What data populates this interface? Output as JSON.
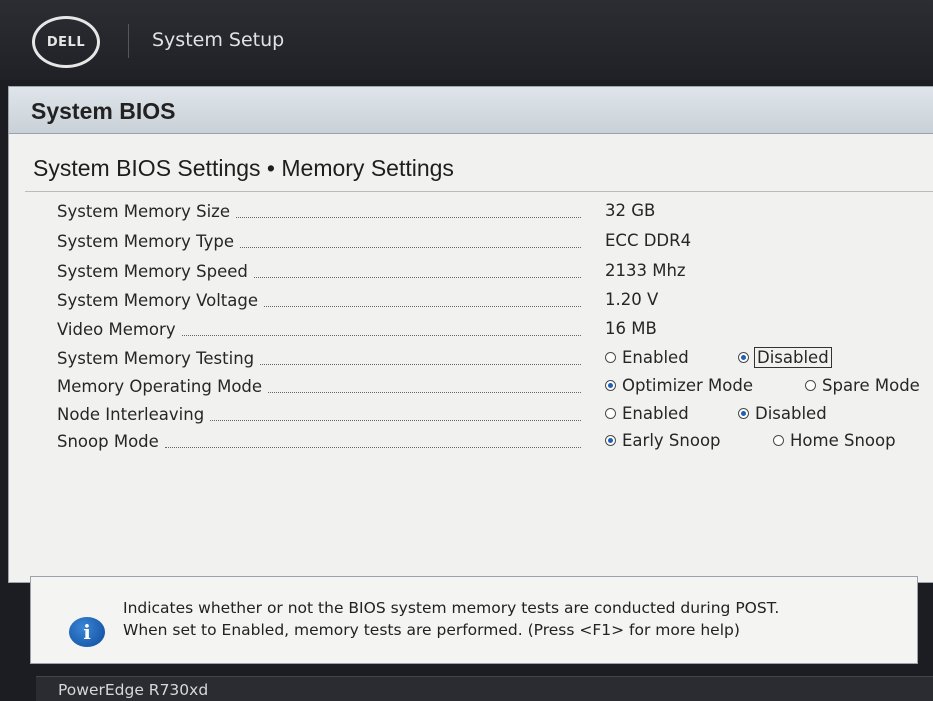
{
  "window": {
    "logo_text": "DELL",
    "title": "System Setup"
  },
  "panel": {
    "title": "System BIOS",
    "section_title": "System BIOS Settings • Memory Settings"
  },
  "settings": [
    {
      "label": "System Memory Size",
      "value": "32 GB"
    },
    {
      "label": "System Memory Type",
      "value": "ECC DDR4"
    },
    {
      "label": "System Memory Speed",
      "value": "2133 Mhz"
    },
    {
      "label": "System Memory Voltage",
      "value": "1.20 V"
    },
    {
      "label": "Video Memory",
      "value": "16 MB"
    },
    {
      "label": "System Memory Testing",
      "options": [
        "Enabled",
        "Disabled"
      ],
      "selected": "Disabled"
    },
    {
      "label": "Memory Operating Mode",
      "options": [
        "Optimizer Mode",
        "Spare Mode"
      ],
      "selected": "Optimizer Mode"
    },
    {
      "label": "Node Interleaving",
      "options": [
        "Enabled",
        "Disabled"
      ],
      "selected": "Disabled"
    },
    {
      "label": "Snoop Mode",
      "options": [
        "Early Snoop",
        "Home Snoop"
      ],
      "selected": "Early Snoop"
    }
  ],
  "help": {
    "icon": "info-icon",
    "line1": "Indicates whether or not the BIOS system memory tests are conducted during POST.",
    "line2": "When set to Enabled, memory tests are performed. (Press <F1> for more help)"
  },
  "footer": {
    "model": "PowerEdge R730xd"
  },
  "colors": {
    "accent": "#1f5fb8",
    "panel_bg": "#f1f1ef",
    "header_bg": "#c9d1d8"
  }
}
